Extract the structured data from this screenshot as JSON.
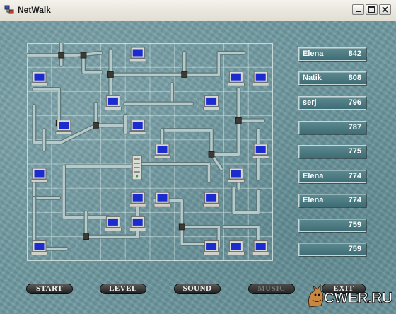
{
  "window": {
    "title": "NetWalk",
    "icon": "netwalk-app-icon",
    "controls": [
      "minimize-icon",
      "maximize-icon",
      "close-icon"
    ]
  },
  "board": {
    "cols": 10,
    "rows": 9,
    "server": {
      "col": 4,
      "row": 5
    },
    "computers": [
      [
        4,
        0
      ],
      [
        0,
        1
      ],
      [
        8,
        1
      ],
      [
        9,
        1
      ],
      [
        3,
        2
      ],
      [
        7,
        2
      ],
      [
        1,
        3
      ],
      [
        4,
        3
      ],
      [
        5,
        4
      ],
      [
        9,
        4
      ],
      [
        0,
        5
      ],
      [
        8,
        5
      ],
      [
        4,
        6
      ],
      [
        5,
        6
      ],
      [
        7,
        6
      ],
      [
        3,
        7
      ],
      [
        4,
        7
      ],
      [
        0,
        8
      ],
      [
        7,
        8
      ],
      [
        8,
        8
      ],
      [
        9,
        8
      ]
    ]
  },
  "scoreboard": {
    "entries": [
      {
        "name": "Elena",
        "score": "842"
      },
      {
        "name": "Natik",
        "score": "808"
      },
      {
        "name": "serj",
        "score": "796"
      },
      {
        "name": "",
        "score": "787"
      },
      {
        "name": "",
        "score": "775"
      },
      {
        "name": "Elena",
        "score": "774"
      },
      {
        "name": "Elena",
        "score": "774"
      },
      {
        "name": "",
        "score": "759"
      },
      {
        "name": "",
        "score": "759"
      }
    ]
  },
  "buttons": {
    "start": "START",
    "level": "LEVEL",
    "sound": "SOUND",
    "music": "MUSIC",
    "exit": "EXIT"
  },
  "watermark": "CWER.RU",
  "colors": {
    "background": "#6f9aa1",
    "pipe": "#8fa9ab",
    "monitor_screen": "#1a2bd0",
    "score_text": "#ffffff"
  }
}
